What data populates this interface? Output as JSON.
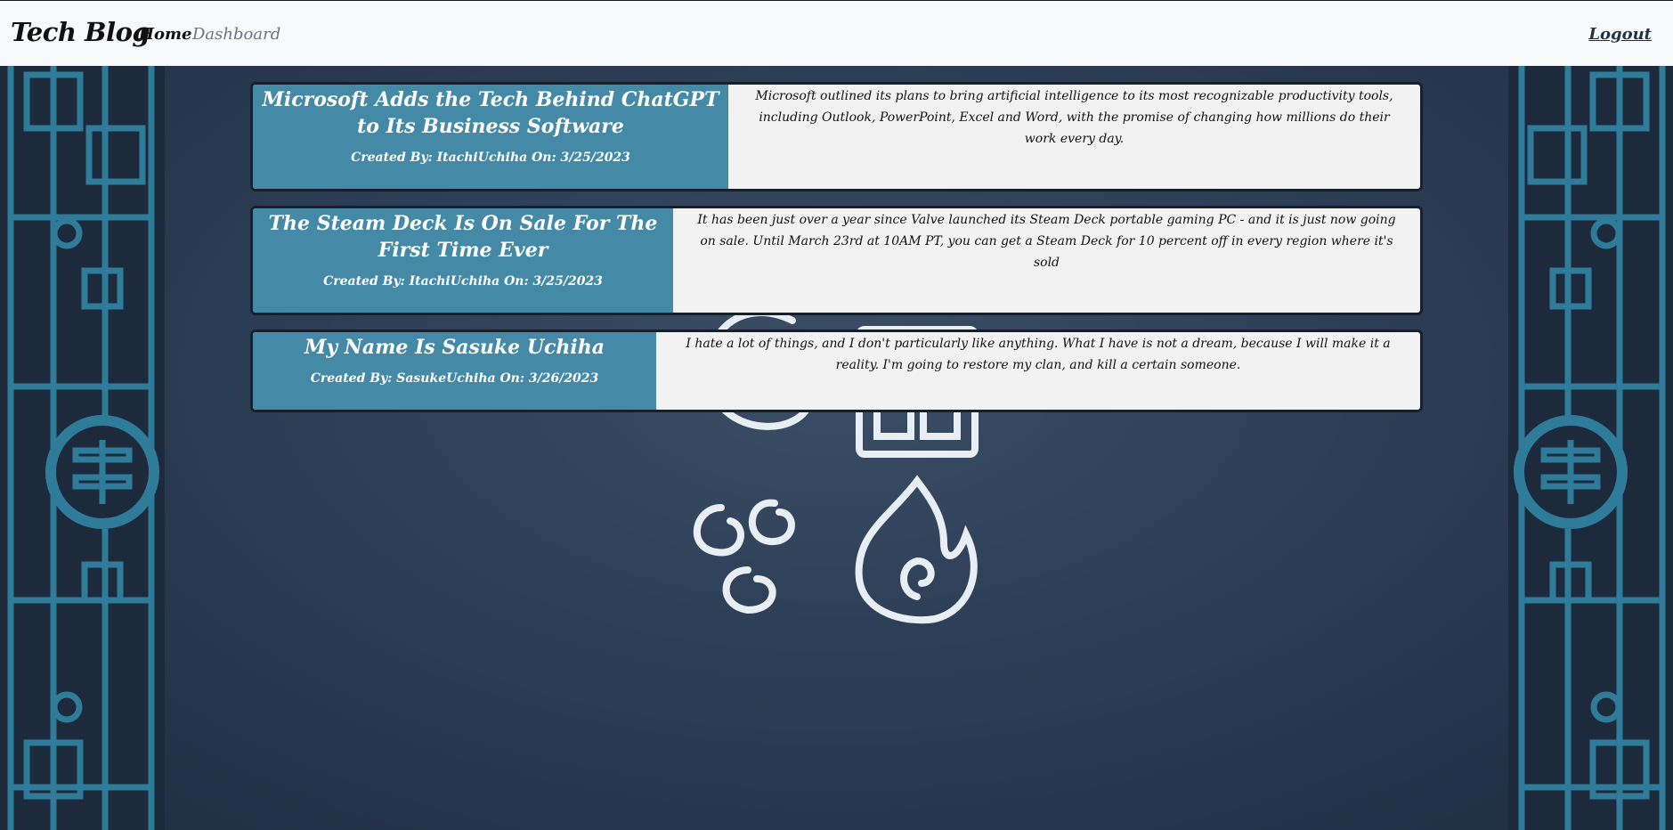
{
  "navbar": {
    "brand": "Tech Blog",
    "home_label": "Home",
    "dashboard_label": "Dashboard",
    "logout_label": "Logout"
  },
  "colors": {
    "navbar_bg": "#f8f9fa",
    "post_header_bg": "#448aa6",
    "post_body_bg": "#f2f2f2",
    "page_bg": "#2c3e55",
    "frame_accent": "#2f7c9a"
  },
  "posts": [
    {
      "title": "Microsoft Adds the Tech Behind ChatGPT to Its Business Software",
      "meta": "Created By: ItachiUchiha On: 3/25/2023",
      "body": "Microsoft outlined its plans to bring artificial intelligence to its most recognizable productivity tools, including Outlook, PowerPoint, Excel and Word, with the promise of changing how millions do their work every day."
    },
    {
      "title": "The Steam Deck Is On Sale For The First Time Ever",
      "meta": "Created By: ItachiUchiha On: 3/25/2023",
      "body": "It has been just over a year since Valve launched its Steam Deck portable gaming PC - and it is just now going on sale. Until March 23rd at 10AM PT, you can get a Steam Deck for 10 percent off in every region where it's sold"
    },
    {
      "title": "My Name Is Sasuke Uchiha",
      "meta": "Created By: SasukeUchiha On: 3/26/2023",
      "body": "I hate a lot of things, and I don't particularly like anything. What I have is not a dream, because I will make it a reality. I'm going to restore my clan, and kill a certain someone."
    }
  ],
  "background": {
    "emblem_icons": [
      "water-icon",
      "earth-icon",
      "air-icon",
      "fire-icon"
    ],
    "frame_icons": [
      "lattice-frame-icon"
    ]
  }
}
